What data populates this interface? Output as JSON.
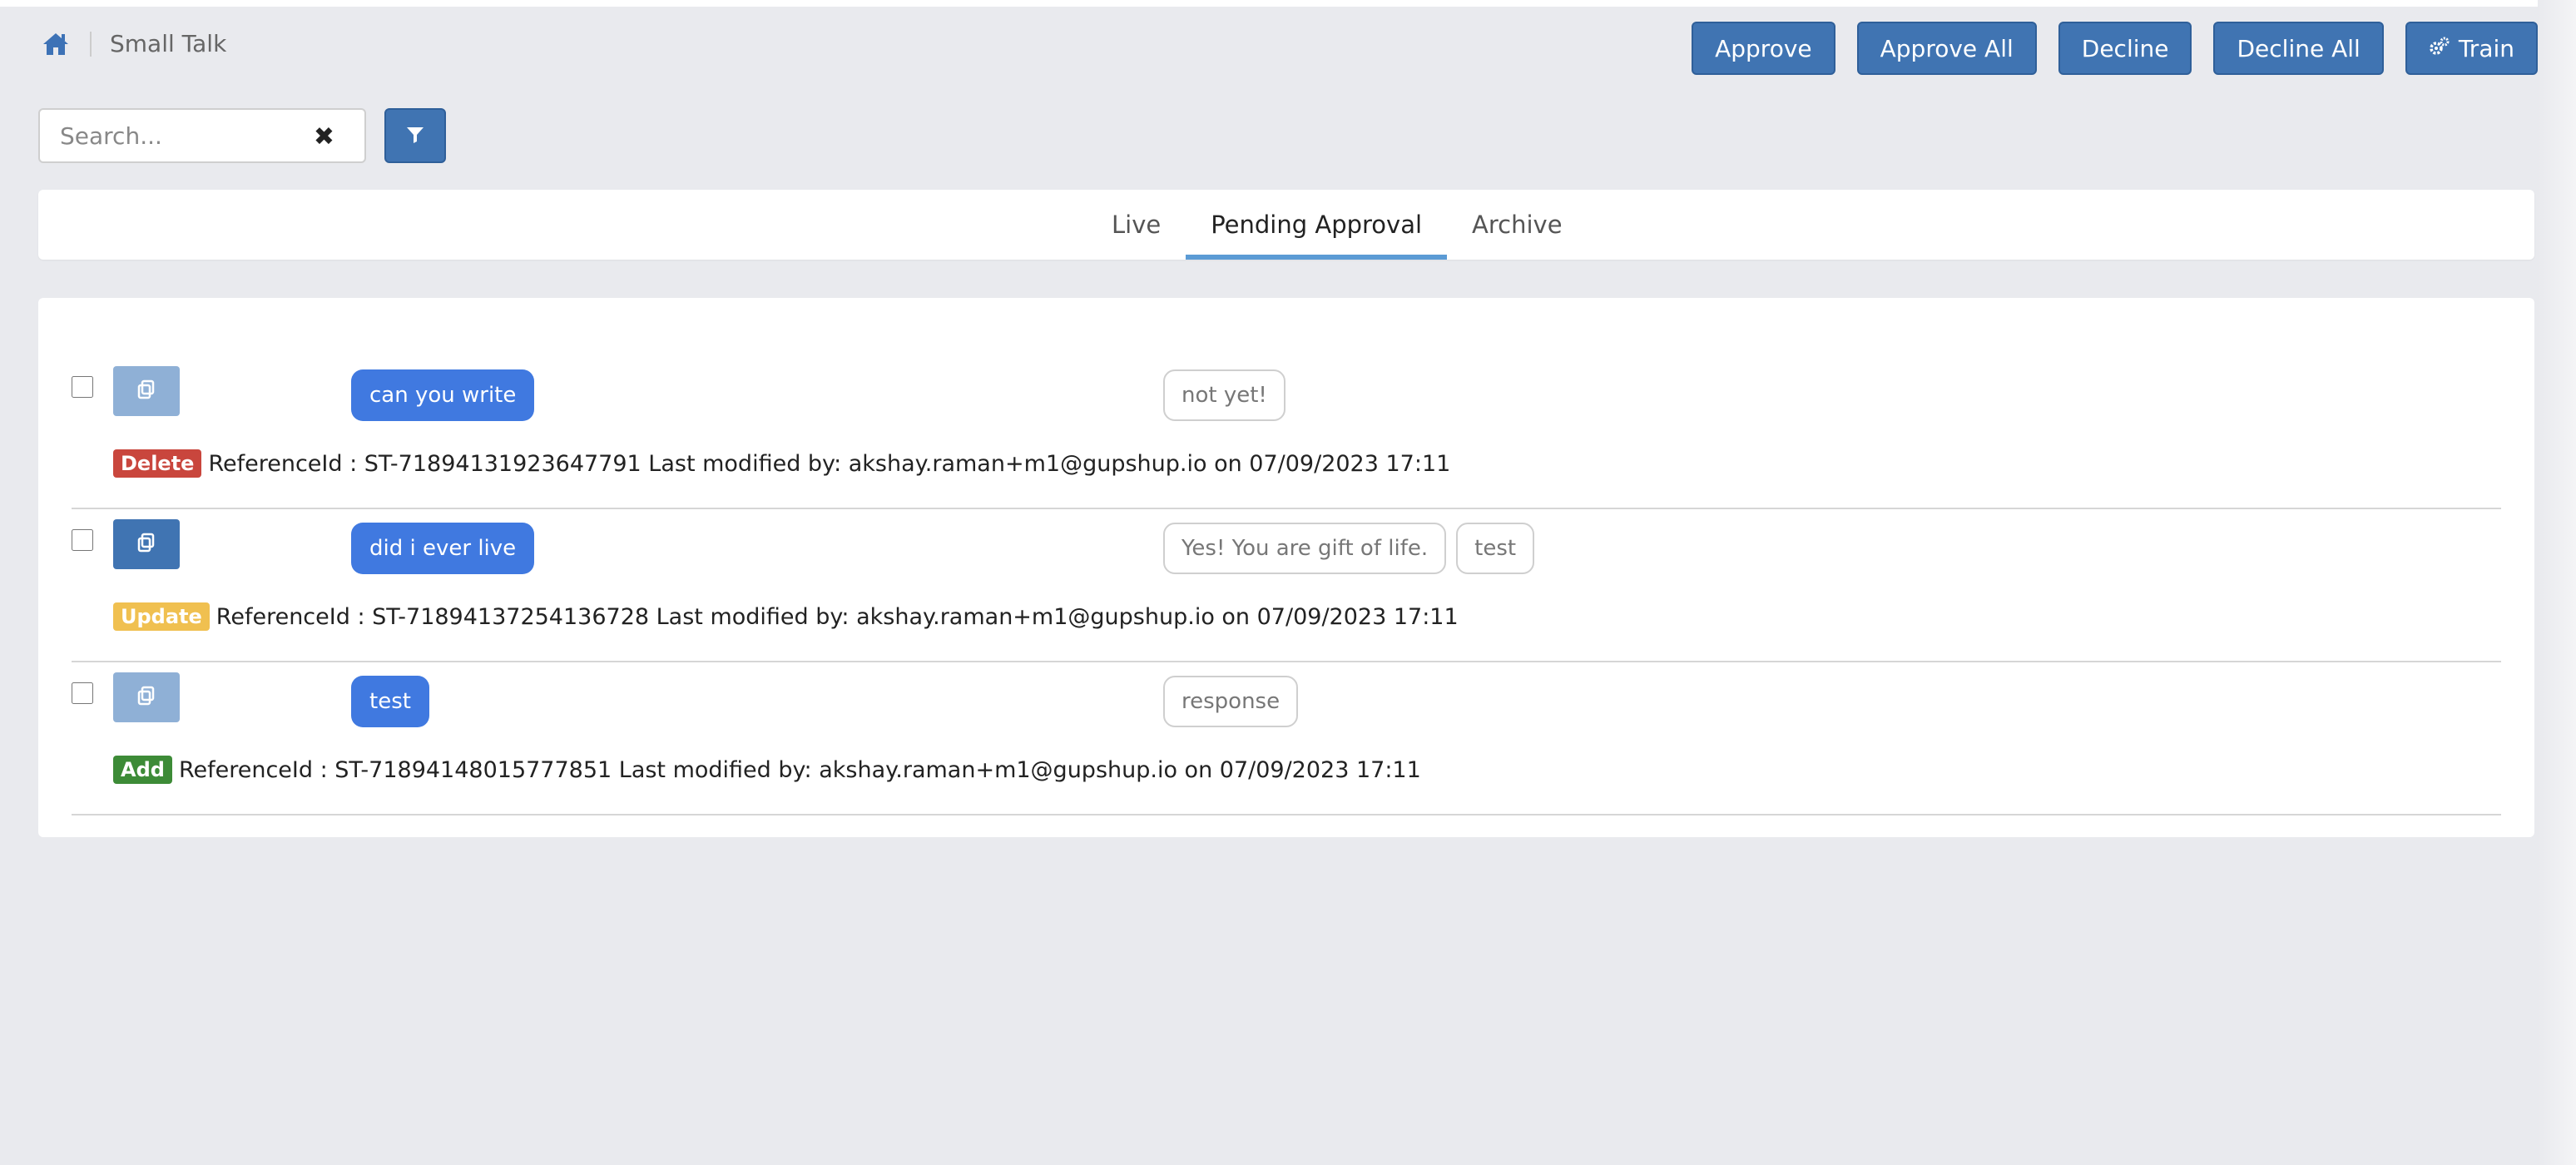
{
  "header": {
    "breadcrumb_title": "Small Talk",
    "actions": {
      "approve": "Approve",
      "approve_all": "Approve All",
      "decline": "Decline",
      "decline_all": "Decline All",
      "train": "Train"
    }
  },
  "search": {
    "placeholder": "Search...",
    "value": ""
  },
  "tabs": [
    {
      "label": "Live",
      "active": false
    },
    {
      "label": "Pending Approval",
      "active": true
    },
    {
      "label": "Archive",
      "active": false
    }
  ],
  "colors": {
    "primary": "#4074b2",
    "chip": "#4079e0",
    "tab_indicator": "#5b9bd5",
    "badge_delete": "#c9463d",
    "badge_update": "#f0c050",
    "badge_add": "#3d8b37"
  },
  "rows": [
    {
      "checked": false,
      "query": "can you write",
      "responses": [
        "not yet!"
      ],
      "badge": "Delete",
      "meta": "ReferenceId : ST-71894131923647791 Last modified by: akshay.raman+m1@gupshup.io on 07/09/2023 17:11"
    },
    {
      "checked": false,
      "query": "did i ever live",
      "responses": [
        "Yes! You are gift of life.",
        "test"
      ],
      "badge": "Update",
      "meta": "ReferenceId : ST-71894137254136728 Last modified by: akshay.raman+m1@gupshup.io on 07/09/2023 17:11"
    },
    {
      "checked": false,
      "query": "test",
      "responses": [
        "response"
      ],
      "badge": "Add",
      "meta": "ReferenceId : ST-71894148015777851 Last modified by: akshay.raman+m1@gupshup.io on 07/09/2023 17:11"
    }
  ]
}
